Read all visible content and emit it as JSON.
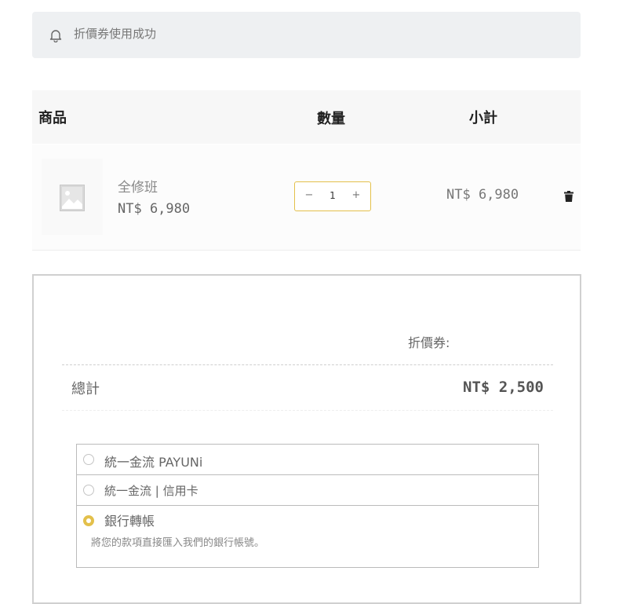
{
  "notice": {
    "message": "折價券使用成功",
    "icon": "bell-icon"
  },
  "cart_table": {
    "headers": {
      "product": "商品",
      "quantity": "數量",
      "subtotal": "小計"
    },
    "items": [
      {
        "name": "全修班",
        "price": "NT$ 6,980",
        "quantity": "1",
        "line_total": "NT$ 6,980"
      }
    ],
    "stepper": {
      "minus": "−",
      "plus": "+"
    }
  },
  "totals": {
    "coupon_label": "折價券:",
    "total_label": "總計",
    "total_value": "NT$ 2,500"
  },
  "payment_methods": {
    "options": [
      {
        "label": "統一金流 PAYUNi",
        "selected": false
      },
      {
        "label": "統一金流 | 信用卡",
        "selected": false
      },
      {
        "label": "銀行轉帳",
        "selected": true,
        "description": "將您的款項直接匯入我們的銀行帳號。"
      }
    ]
  },
  "colors": {
    "accent": "#e3c04b",
    "notice_bg": "#eef0f2",
    "header_bg": "#f7f7f7"
  }
}
